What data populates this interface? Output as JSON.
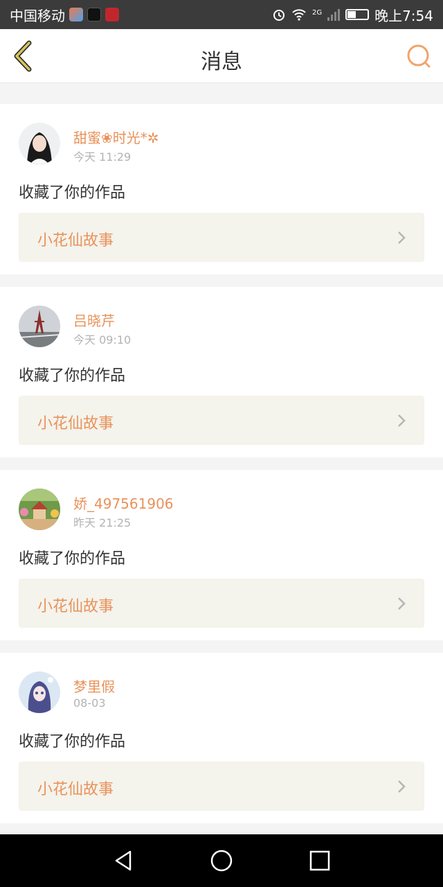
{
  "status_bar": {
    "carrier": "中国移动",
    "network": "2G",
    "time": "晚上7:54"
  },
  "header": {
    "title": "消息"
  },
  "colors": {
    "accent": "#e9925a",
    "back_icon": "#c9b24a",
    "card_bg": "#ffffff",
    "work_bg": "#f4f3ec",
    "page_bg": "#f4f4f4"
  },
  "messages": [
    {
      "name": "甜蜜❀时光*✲",
      "time": "今天 11:29",
      "action": "收藏了你的作品",
      "work": "小花仙故事",
      "avatar": "avatar-woman"
    },
    {
      "name": "吕晓芹",
      "time": "今天 09:10",
      "action": "收藏了你的作品",
      "work": "小花仙故事",
      "avatar": "avatar-eiffel-tower"
    },
    {
      "name": "娇_497561906",
      "time": "昨天 21:25",
      "action": "收藏了你的作品",
      "work": "小花仙故事",
      "avatar": "avatar-garden-house"
    },
    {
      "name": "梦里假",
      "time": "08-03",
      "action": "收藏了你的作品",
      "work": "小花仙故事",
      "avatar": "avatar-anime-girl"
    }
  ],
  "icons": {
    "back": "chevron-left-icon",
    "search": "search-icon",
    "work_arrow": "chevron-right-icon",
    "nav_back": "triangle-back-icon",
    "nav_home": "circle-home-icon",
    "nav_recent": "square-recent-icon"
  }
}
